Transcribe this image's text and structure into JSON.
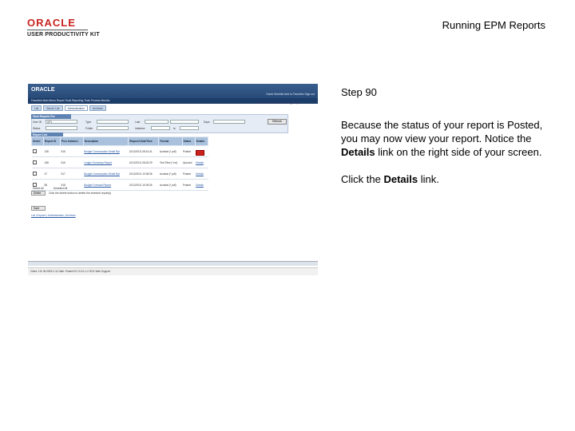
{
  "header": {
    "logo_brand": "ORACLE",
    "logo_product": "USER PRODUCTIVITY KIT",
    "doc_title": "Running EPM Reports"
  },
  "step": {
    "label": "Step 90",
    "para1_prefix": "Because the status of your report is Posted, you may now view your report. Notice the ",
    "para1_bold": "Details",
    "para1_suffix": " link on the right side of your screen.",
    "para2_prefix": "Click the ",
    "para2_bold": "Details",
    "para2_suffix": " link."
  },
  "screenshot": {
    "brand": "ORACLE",
    "top_links": "Home  Worklist  Add to Favorites  Sign out",
    "nav": "Favorites  Main Menu  Report Tools  Reporting Tools  Process Monitor",
    "tabs": [
      "List",
      "Server List",
      "Administration",
      "Archives"
    ],
    "tools": "New Window  Customize Page  http",
    "filter_header": "View Reports For",
    "filter_labels": [
      "User ID",
      "Type",
      "Last",
      "Days",
      "Status",
      "Folder",
      "Instance",
      "to"
    ],
    "filter_value_user": "VP1",
    "refresh_label": "Refresh",
    "grid_header": "Report List",
    "columns": [
      "Select",
      "Report ID",
      "Prcs Instance",
      "Description",
      "Request Date/Time",
      "Format",
      "Status",
      "Details"
    ],
    "rows": [
      {
        "id": "138",
        "inst": "515",
        "desc": "Budget Consumption Detail Rpt",
        "date": "10/12/2011 08:41:41",
        "format": "Acrobat (*.pdf)",
        "status": "Posted",
        "details": "Details"
      },
      {
        "id": "158",
        "inst": "516",
        "desc": "Ledger Summary Report",
        "date": "10/12/2011 08:40:29",
        "format": "Text Files (*.txt)",
        "status": "Queued",
        "details": "Details"
      },
      {
        "id": "27",
        "inst": "517",
        "desc": "Budget Consumption Detail Rpt",
        "date": "10/12/2011 10:08:36",
        "format": "Acrobat (*.pdf)",
        "status": "Posted",
        "details": "Details"
      },
      {
        "id": "58",
        "inst": "518",
        "desc": "Budget Forecast Report",
        "date": "10/12/2011 10:09:26",
        "format": "Acrobat (*.pdf)",
        "status": "Posted",
        "details": "Details"
      }
    ],
    "select_all": "Select All",
    "deselect_all": "Deselect All",
    "delete_label": "Delete",
    "delete_note": "Click the delete button to delete the selected report(s)",
    "save_label": "Save",
    "footer_links": "List | Explore | Administration | Archives",
    "status_bar": "Client: 110 IN-0309-2-11   Date: Posted 91 10-10-1-2 2011   Web Support"
  },
  "colors": {
    "oracle_red": "#c8231f",
    "brand_blue": "#274a78",
    "highlight": "#c8231f"
  }
}
